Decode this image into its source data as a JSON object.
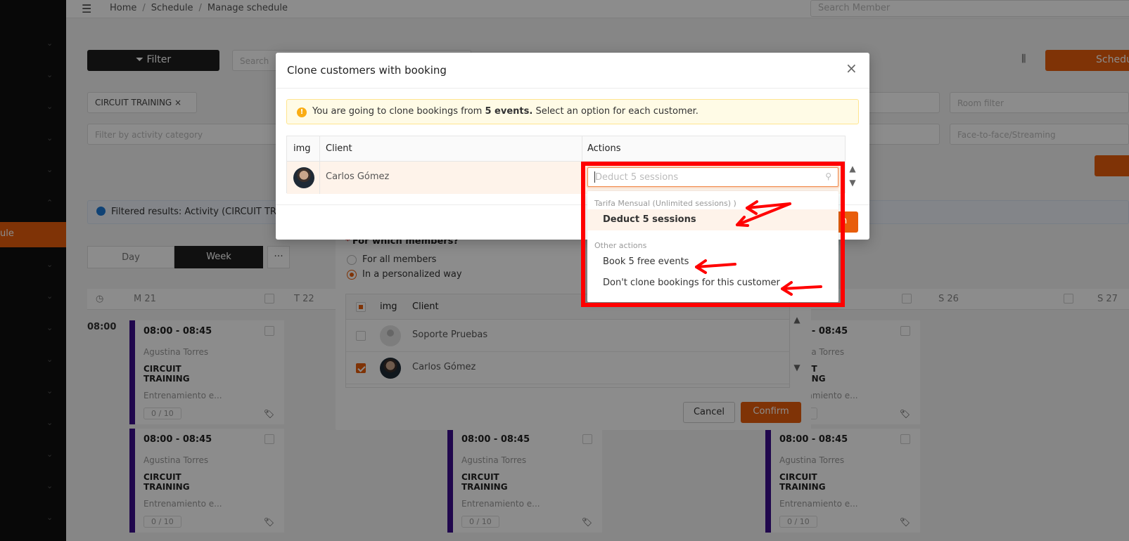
{
  "breadcrumb": [
    "Home",
    "Schedule",
    "Manage schedule"
  ],
  "top_search": {
    "placeholder": "Search Member"
  },
  "sidebar": {
    "active_label": "ule"
  },
  "toolbar": {
    "filter_label": "Filter",
    "search_placeholder": "Search",
    "schedule_label": "Schedu",
    "activity_tag": "CIRCUIT TRAINING ×",
    "category_placeholder": "Filter by activity category",
    "room_placeholder": "Room filter",
    "mode_placeholder": "Face-to-face/Streaming"
  },
  "filtered_results": "Filtered results: Activity (CIRCUIT TR",
  "view_toggle": {
    "day": "Day",
    "week": "Week",
    "more": "···"
  },
  "calendar": {
    "days": [
      "M 21",
      "T 22",
      "S 26",
      "S 27"
    ],
    "time_label": "08:00",
    "events": [
      {
        "time": "08:00 - 08:45",
        "instructor": "Agustina Torres",
        "activity": "CIRCUIT TRAINING",
        "description": "Entrenamiento e...",
        "capacity": "0 / 10"
      },
      {
        "time": "08:00 - 08:45",
        "instructor": "Agustina Torres",
        "activity": "CIRCUIT TRAINING",
        "description": "Entrenamiento e...",
        "capacity": "0 / 10"
      },
      {
        "time": "08:00 - 08:45",
        "instructor": "Agustina Torres",
        "activity": "CIRCUIT TRAINING",
        "description": "Entrenamiento e...",
        "capacity": "0 / 10"
      },
      {
        "time": "08:00 - 08:45",
        "instructor": "Agustina Torres",
        "activity": "CIRCUIT TRAINING",
        "description": "Entrenamiento e...",
        "capacity": "0 / 10"
      },
      {
        "time": "08:00 - 08:45",
        "instructor": "Agustina Torres",
        "activity": "CIRCUIT TRAINING",
        "description": "Entrenamiento e...",
        "capacity": "0 / 10"
      },
      {
        "time": "08:00 - 08:45",
        "instructor": "Agustina Torres",
        "activity": "CIRCUIT TRAINING",
        "description": "Entrenamiento e...",
        "capacity": "0 / 10"
      }
    ]
  },
  "members_dialog": {
    "question": "For which members?",
    "required_mark": "*",
    "option_all": "For all members",
    "option_personalized": "In a personalized way",
    "columns": {
      "img": "img",
      "client": "Client"
    },
    "rows": [
      {
        "name": "Soporte Pruebas",
        "checked": false
      },
      {
        "name": "Carlos Gómez",
        "checked": true
      }
    ],
    "cancel_label": "Cancel",
    "confirm_label": "Confirm"
  },
  "clone_dialog": {
    "title": "Clone customers with booking",
    "close_icon": "×",
    "alert": {
      "prefix": "You are going to clone bookings from ",
      "bold": "5 events.",
      "suffix": " Select an option for each customer."
    },
    "columns": {
      "img": "img",
      "client": "Client",
      "actions": "Actions"
    },
    "row": {
      "name": "Carlos Gómez"
    },
    "ok_label": "n",
    "select": {
      "placeholder": "Deduct 5 sessions",
      "search_icon": "⚲"
    },
    "dropdown": {
      "groups": [
        {
          "label": "Tarifa Mensual (Unlimited sessions) )",
          "options": [
            "Deduct 5 sessions"
          ]
        },
        {
          "label": "Other actions",
          "options": [
            "Book 5 free events",
            "Don't clone bookings for this customer"
          ]
        }
      ],
      "selected": "Deduct 5 sessions"
    }
  },
  "colors": {
    "accent": "#e85d0c",
    "annotation": "#ff0000",
    "event_bar": "#3b0d8c"
  }
}
